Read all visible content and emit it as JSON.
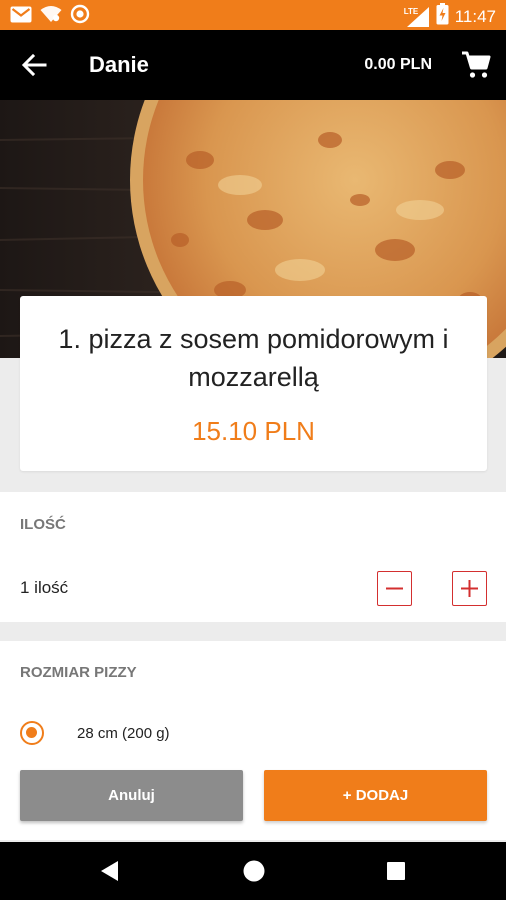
{
  "status_bar": {
    "time": "11:47",
    "network": "LTE",
    "icons": [
      "gmail-icon",
      "wifi-icon",
      "record-icon",
      "signal-icon",
      "battery-icon"
    ]
  },
  "app_bar": {
    "title": "Danie",
    "cart_total": "0.00 PLN",
    "icons": [
      "arrow-back-icon",
      "cart-icon"
    ]
  },
  "product": {
    "name": "1. pizza z sosem pomidorowym i mozzarellą",
    "price": "15.10 PLN"
  },
  "quantity": {
    "heading": "ILOŚĆ",
    "value": 1,
    "text": "1 ilość",
    "icons": [
      "minus-icon",
      "plus-icon"
    ]
  },
  "size": {
    "heading": "ROZMIAR PIZZY",
    "options": [
      {
        "label": "28 cm (200 g)",
        "selected": true
      }
    ]
  },
  "actions": {
    "cancel_label": "Anuluj",
    "add_label": "+ DODAJ"
  },
  "navigation": {
    "icons": [
      "back-triangle-icon",
      "home-circle-icon",
      "recents-square-icon"
    ]
  },
  "colors": {
    "accent": "#f07d1a",
    "stepper": "#d32f2f",
    "cancel": "#8c8c8c"
  }
}
